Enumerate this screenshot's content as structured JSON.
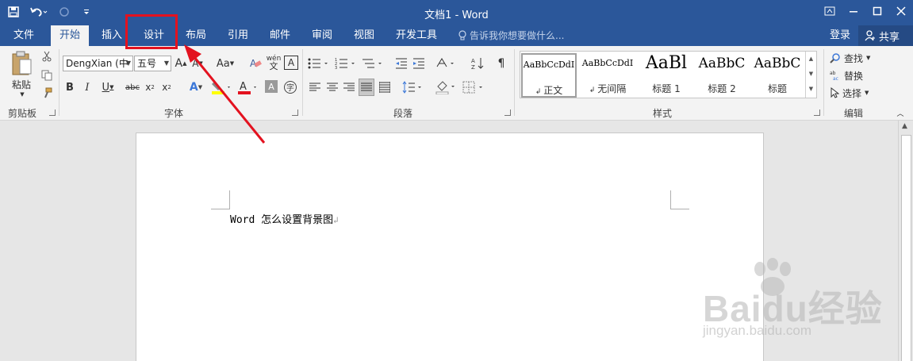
{
  "titlebar": {
    "title": "文档1 - Word",
    "accent_color": "#2b579a"
  },
  "tabs": [
    {
      "label": "文件"
    },
    {
      "label": "开始"
    },
    {
      "label": "插入"
    },
    {
      "label": "设计"
    },
    {
      "label": "布局"
    },
    {
      "label": "引用"
    },
    {
      "label": "邮件"
    },
    {
      "label": "审阅"
    },
    {
      "label": "视图"
    },
    {
      "label": "开发工具"
    }
  ],
  "tellme": "告诉我你想要做什么...",
  "login": "登录",
  "share": "共享",
  "ribbon": {
    "clipboard": {
      "paste": "粘贴",
      "label": "剪贴板"
    },
    "font": {
      "font_name": "DengXian (中",
      "font_size": "五号",
      "label": "字体"
    },
    "paragraph": {
      "label": "段落"
    },
    "styles": {
      "label": "样式",
      "items": [
        {
          "sample": "AaBbCcDdI",
          "name": "正文"
        },
        {
          "sample": "AaBbCcDdI",
          "name": "无间隔"
        },
        {
          "sample": "AaBl",
          "name": "标题 1"
        },
        {
          "sample": "AaBbC",
          "name": "标题 2"
        },
        {
          "sample": "AaBbC",
          "name": "标题"
        }
      ]
    },
    "editing": {
      "find": "查找",
      "replace": "替换",
      "select": "选择",
      "label": "编辑"
    }
  },
  "document": {
    "text": "Word 怎么设置背景图"
  },
  "watermark": {
    "brand": "Baidu经验",
    "url": "jingyan.baidu.com"
  },
  "annotation_color": "#e3121f"
}
